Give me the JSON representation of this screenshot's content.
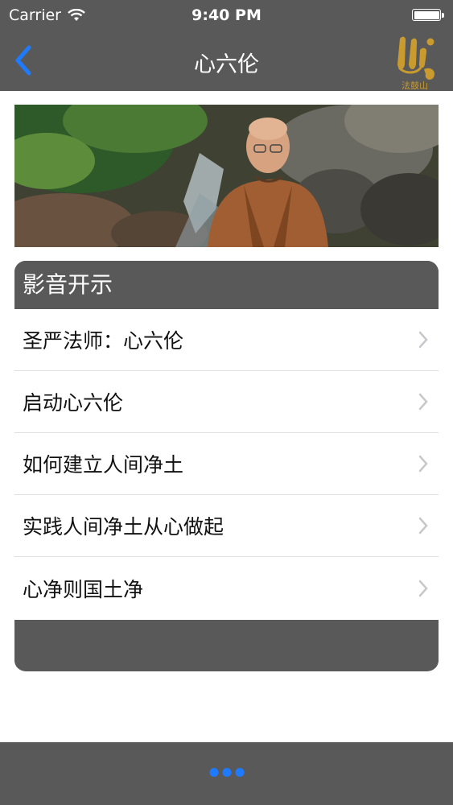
{
  "status_bar": {
    "carrier": "Carrier",
    "time": "9:40 PM",
    "battery_level": 1.0
  },
  "nav": {
    "title": "心六伦",
    "back_icon": "chevron-left-icon",
    "logo_icon": "dharma-drum-logo-icon",
    "logo_text": "法鼓山",
    "accent_color": "#1e7bff"
  },
  "hero": {
    "image": "monk-portrait-photo"
  },
  "section": {
    "title": "影音开示",
    "items": [
      {
        "label": "圣严法师：心六伦"
      },
      {
        "label": "启动心六伦"
      },
      {
        "label": "如何建立人间净土"
      },
      {
        "label": "实践人间净土从心做起"
      },
      {
        "label": "心净则国土净"
      }
    ]
  },
  "bottom_bar": {
    "more_icon": "more-dots-icon"
  },
  "colors": {
    "bar_background": "#5a5959",
    "row_background": "#ffffff",
    "chevron": "#c7c7cc"
  }
}
